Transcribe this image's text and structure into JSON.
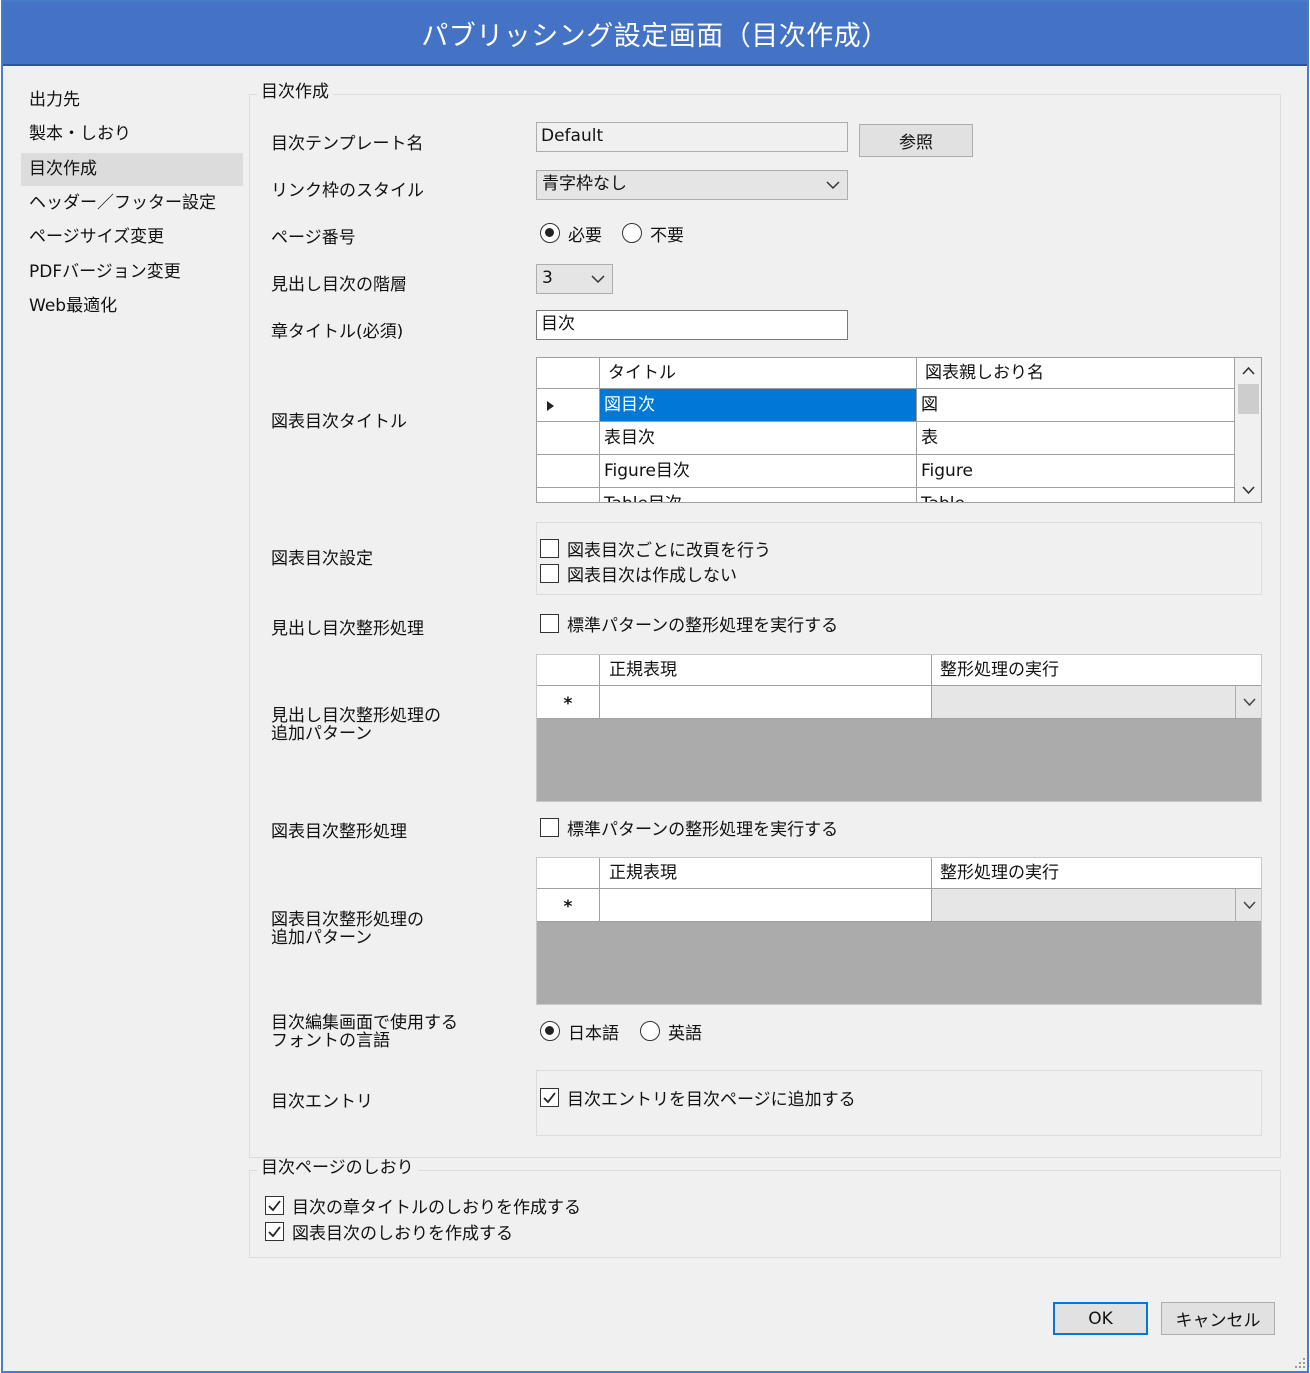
{
  "window": {
    "title": "パブリッシング設定画面（目次作成）"
  },
  "sidebar": {
    "items": [
      {
        "label": "出力先"
      },
      {
        "label": "製本・しおり"
      },
      {
        "label": "目次作成"
      },
      {
        "label": "ヘッダー／フッター設定"
      },
      {
        "label": "ページサイズ変更"
      },
      {
        "label": "PDFバージョン変更"
      },
      {
        "label": "Web最適化"
      }
    ],
    "selected": "目次作成"
  },
  "toc_group": {
    "title": "目次作成",
    "template": {
      "label": "目次テンプレート名",
      "value": "Default",
      "browse_label": "参照"
    },
    "link_style": {
      "label": "リンク枠のスタイル",
      "value": "青字枠なし"
    },
    "page_number": {
      "label": "ページ番号",
      "option_required": "必要",
      "option_not_required": "不要",
      "selected": "必要"
    },
    "heading_level": {
      "label": "見出し目次の階層",
      "value": "3"
    },
    "chapter_title": {
      "label": "章タイトル(必須)",
      "value": "目次"
    },
    "figure_toc_titles": {
      "label": "図表目次タイトル",
      "columns": [
        "タイトル",
        "図表親しおり名"
      ],
      "rows": [
        {
          "title": "図目次",
          "parent": "図"
        },
        {
          "title": "表目次",
          "parent": "表"
        },
        {
          "title": "Figure目次",
          "parent": "Figure"
        },
        {
          "title": "Table目次",
          "parent": "Table"
        }
      ]
    },
    "figure_toc_settings": {
      "label": "図表目次設定",
      "option_page_break": "図表目次ごとに改頁を行う",
      "option_no_create": "図表目次は作成しない"
    },
    "heading_format": {
      "label": "見出し目次整形処理",
      "option": "標準パターンの整形処理を実行する"
    },
    "heading_format_patterns": {
      "label_line1": "見出し目次整形処理の",
      "label_line2": "追加パターン",
      "columns": [
        "正規表現",
        "整形処理の実行"
      ],
      "new_row_marker": "*"
    },
    "figure_format": {
      "label": "図表目次整形処理",
      "option": "標準パターンの整形処理を実行する"
    },
    "figure_format_patterns": {
      "label_line1": "図表目次整形処理の",
      "label_line2": "追加パターン",
      "columns": [
        "正規表現",
        "整形処理の実行"
      ],
      "new_row_marker": "*"
    },
    "font_language": {
      "label_line1": "目次編集画面で使用する",
      "label_line2": "フォントの言語",
      "option_japanese": "日本語",
      "option_english": "英語",
      "selected": "日本語"
    },
    "toc_entry": {
      "label": "目次エントリ",
      "option": "目次エントリを目次ページに追加する",
      "checked": true
    }
  },
  "bookmark_group": {
    "title": "目次ページのしおり",
    "option_chapter": "目次の章タイトルのしおりを作成する",
    "option_figure": "図表目次のしおりを作成する",
    "chapter_checked": true,
    "figure_checked": true
  },
  "footer": {
    "ok_label": "OK",
    "cancel_label": "キャンセル"
  }
}
